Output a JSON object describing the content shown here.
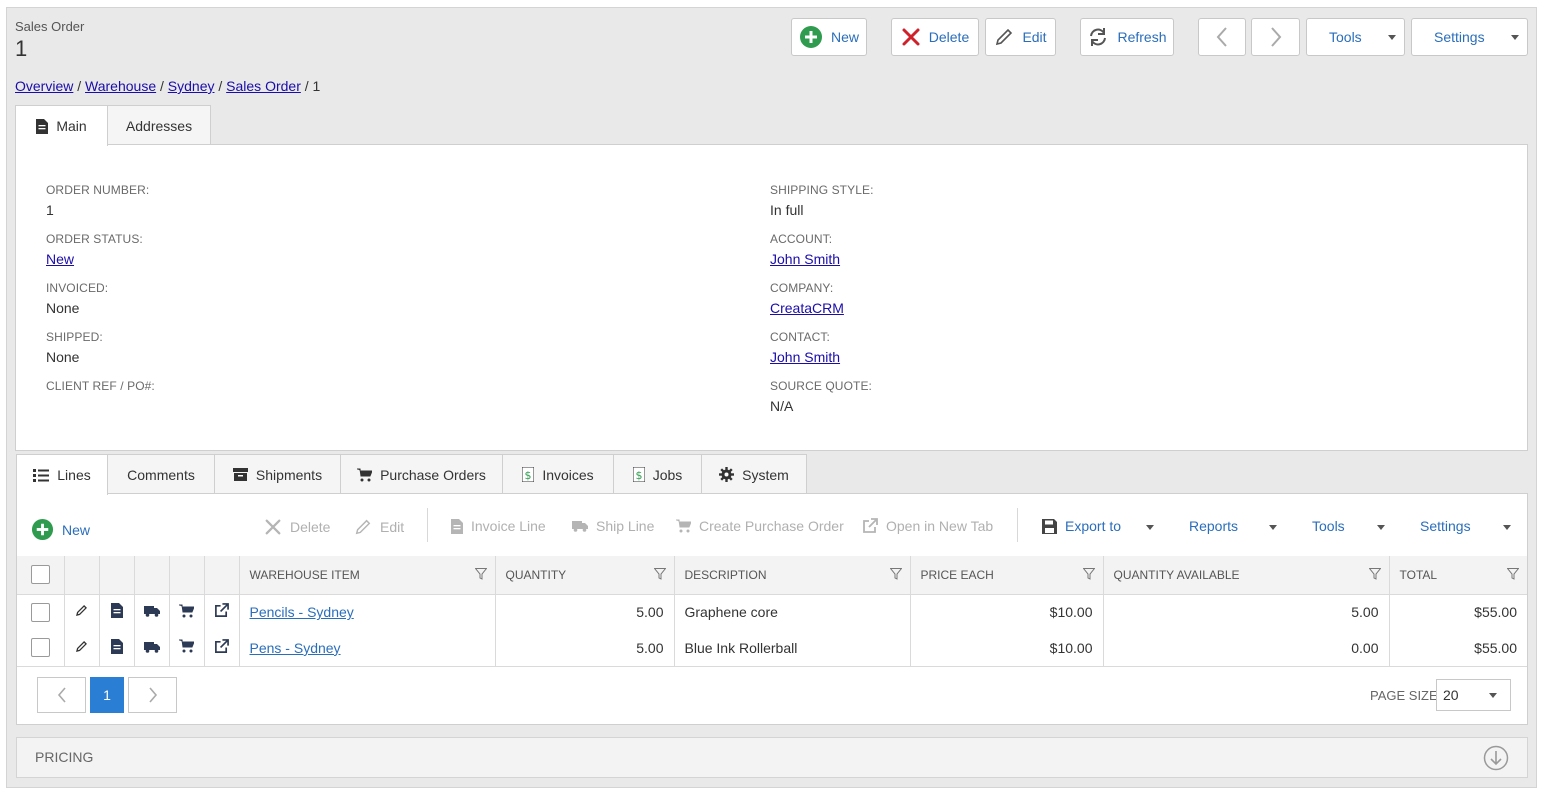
{
  "header": {
    "title": "Sales Order",
    "record_number": "1"
  },
  "toolbar": {
    "new": "New",
    "delete": "Delete",
    "edit": "Edit",
    "refresh": "Refresh",
    "tools": "Tools",
    "settings": "Settings"
  },
  "breadcrumb": {
    "items": [
      "Overview",
      "Warehouse",
      "Sydney",
      "Sales Order"
    ],
    "separator": "/",
    "current": "1"
  },
  "top_tabs": [
    "Main",
    "Addresses"
  ],
  "fields_left": [
    {
      "label": "ORDER NUMBER:",
      "value": "1",
      "link": false
    },
    {
      "label": "ORDER STATUS:",
      "value": "New",
      "link": true
    },
    {
      "label": "INVOICED:",
      "value": "None",
      "link": false
    },
    {
      "label": "SHIPPED:",
      "value": "None",
      "link": false
    },
    {
      "label": "CLIENT REF / PO#:",
      "value": "",
      "link": false
    }
  ],
  "fields_right": [
    {
      "label": "SHIPPING STYLE:",
      "value": "In full",
      "link": false
    },
    {
      "label": "ACCOUNT:",
      "value": "John Smith",
      "link": true
    },
    {
      "label": "COMPANY:",
      "value": "CreataCRM",
      "link": true
    },
    {
      "label": "CONTACT:",
      "value": "John Smith",
      "link": true
    },
    {
      "label": "SOURCE QUOTE:",
      "value": "N/A",
      "link": false
    }
  ],
  "bottom_tabs": [
    "Lines",
    "Comments",
    "Shipments",
    "Purchase Orders",
    "Invoices",
    "Jobs",
    "System"
  ],
  "lines_toolbar": {
    "new": "New",
    "delete": "Delete",
    "edit": "Edit",
    "invoice_line": "Invoice Line",
    "ship_line": "Ship Line",
    "create_po": "Create Purchase Order",
    "open_new_tab": "Open in New Tab",
    "export_to": "Export to",
    "reports": "Reports",
    "tools": "Tools",
    "settings": "Settings"
  },
  "grid": {
    "columns": [
      "WAREHOUSE ITEM",
      "QUANTITY",
      "DESCRIPTION",
      "PRICE EACH",
      "QUANTITY AVAILABLE",
      "TOTAL"
    ],
    "rows": [
      {
        "item": "Pencils - Sydney",
        "quantity": "5.00",
        "description": "Graphene core",
        "price_each": "$10.00",
        "qty_available": "5.00",
        "total": "$55.00"
      },
      {
        "item": "Pens - Sydney",
        "quantity": "5.00",
        "description": "Blue Ink Rollerball",
        "price_each": "$10.00",
        "qty_available": "0.00",
        "total": "$55.00"
      }
    ]
  },
  "pager": {
    "current_page": "1",
    "page_size_label": "PAGE SIZE",
    "page_size": "20"
  },
  "pricing": {
    "label": "PRICING"
  },
  "colors": {
    "accent": "#2a6ebb",
    "link": "#1a0dab",
    "new_green": "#2e9b4e",
    "delete_red": "#d0202a",
    "active_page": "#2a7fd4"
  }
}
